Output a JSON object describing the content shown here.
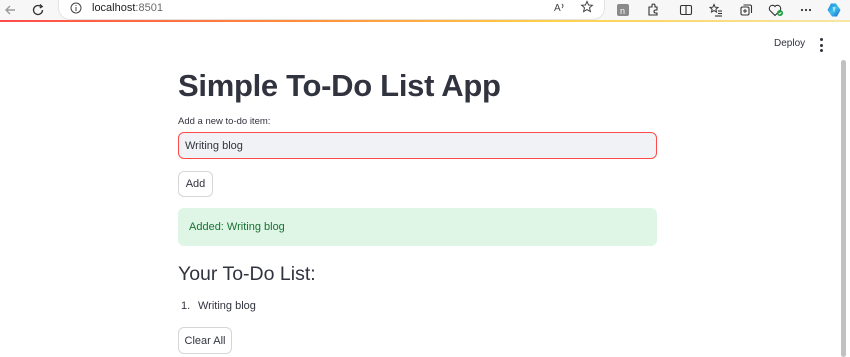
{
  "browser": {
    "url_host": "localhost",
    "url_port": ":8501"
  },
  "header": {
    "deploy_label": "Deploy"
  },
  "main": {
    "title": "Simple To-Do List App",
    "input_label": "Add a new to-do item:",
    "input_value": "Writing blog",
    "add_button_label": "Add",
    "success_message": "Added: Writing blog",
    "list_heading": "Your To-Do List:",
    "todo_items": [
      {
        "number": "1.",
        "text": "Writing blog"
      }
    ],
    "clear_button_label": "Clear All"
  },
  "colors": {
    "accent": "#ff4b4b",
    "success_bg": "#dff5e5",
    "success_text": "#177233",
    "text": "#31333f"
  },
  "icons": {
    "back": "arrow-left-icon",
    "refresh": "refresh-icon",
    "info": "info-icon",
    "read_aloud": "read-aloud-icon",
    "favorite": "star-icon",
    "menu": "more-vertical-icon"
  }
}
